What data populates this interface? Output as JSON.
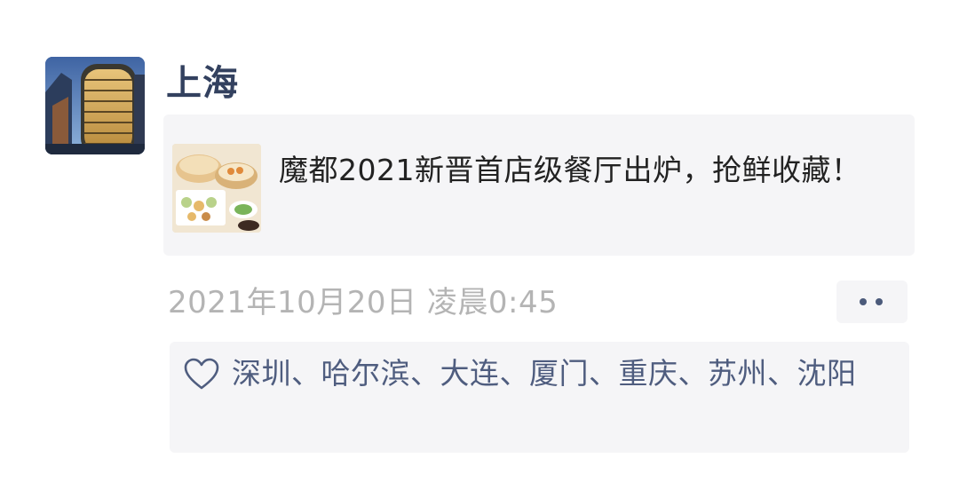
{
  "post": {
    "author": "上海",
    "avatar_icon": "building-photo",
    "link": {
      "thumbnail_icon": "dim-sum-photo",
      "title": "魔都2021新晋首店级餐厅出炉，抢鲜收藏！"
    },
    "timestamp": "2021年10月20日  凌晨0:45",
    "more_icon": "two-dots-icon",
    "likes": {
      "icon": "heart-outline-icon",
      "names": "深圳、哈尔滨、大连、厦门、重庆、苏州、沈阳"
    }
  },
  "colors": {
    "author_name": "#33415f",
    "like_names": "#4f5d7f",
    "timestamp": "#b4b4b4",
    "card_background": "#f5f5f7"
  }
}
